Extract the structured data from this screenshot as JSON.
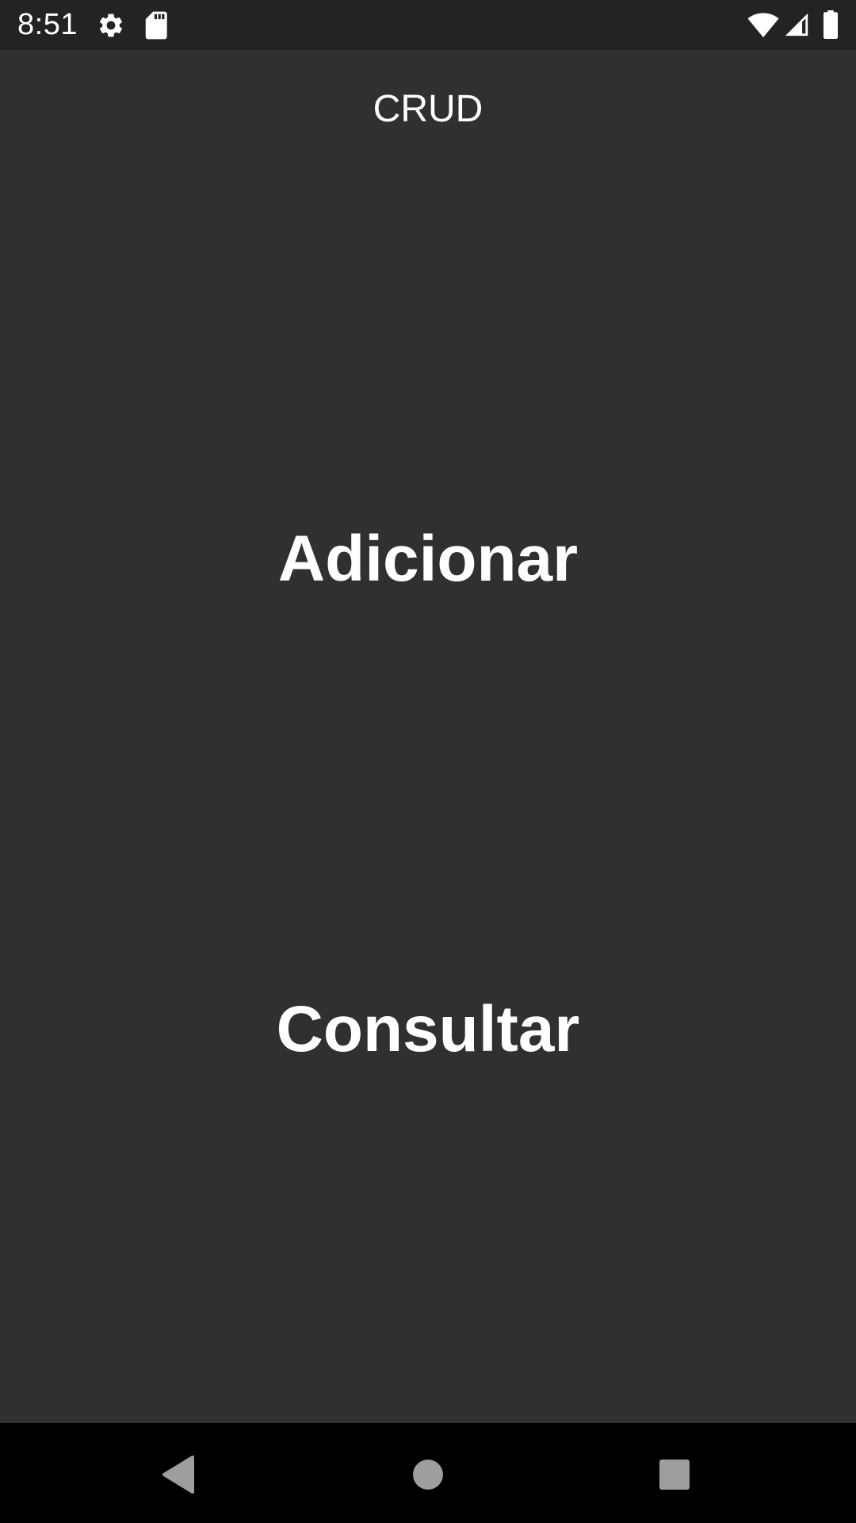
{
  "status_bar": {
    "time": "8:51",
    "icons": [
      "settings-icon",
      "sd-card-icon",
      "wifi-icon",
      "signal-icon",
      "battery-icon"
    ]
  },
  "app": {
    "title": "CRUD"
  },
  "main": {
    "add_label": "Adicionar",
    "query_label": "Consultar"
  },
  "nav_bar": {
    "buttons": [
      "back-icon",
      "home-icon",
      "recents-icon"
    ]
  },
  "colors": {
    "background": "#303030",
    "status_bar": "#232323",
    "nav_bar": "#000000",
    "text": "#ffffff",
    "nav_icons": "#9e9e9e"
  }
}
